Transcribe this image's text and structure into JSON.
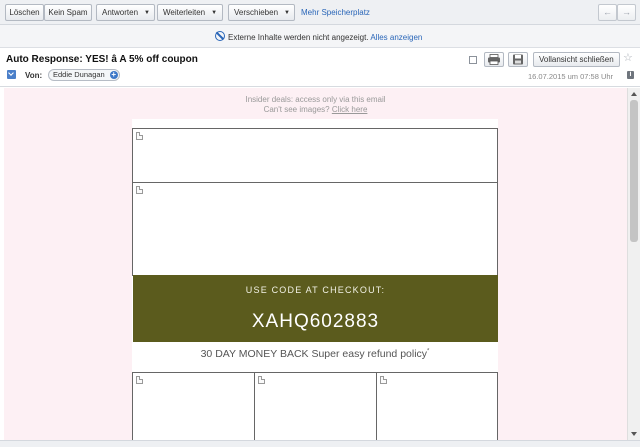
{
  "toolbar": {
    "loeschen": "Löschen",
    "kein_spam": "Kein Spam",
    "antworten": "Antworten",
    "weiterleiten": "Weiterleiten",
    "verschieben": "Verschieben",
    "mehr_speicherplatz": "Mehr Speicherplatz",
    "caret": "▼",
    "prev": "←",
    "next": "→"
  },
  "infobar": {
    "text": "Externe Inhalte werden nicht angezeigt.",
    "link": "Alles anzeigen"
  },
  "header": {
    "subject": "Auto Response: YES! â A 5% off coupon",
    "von_label": "Von:",
    "sender": "Eddie Dunagan",
    "add_contact": "+",
    "date": "16.07.2015 um 07:58 Uhr",
    "info": "i",
    "star": "☆",
    "vollansicht": "Vollansicht schließen"
  },
  "email": {
    "preheader_line1": "Insider deals: access only via this email",
    "preheader_line2": "Can't see images?",
    "click_here": "Click here",
    "coupon_label": "USE CODE AT CHECKOUT:",
    "coupon_code": "XAHQ602883",
    "guarantee": "30 DAY MONEY BACK Super easy refund policy",
    "guarantee_mark": "*"
  },
  "colors": {
    "body_bg": "#fdf0f4",
    "coupon_bg": "#5b5b1d",
    "link": "#2a66b8"
  }
}
